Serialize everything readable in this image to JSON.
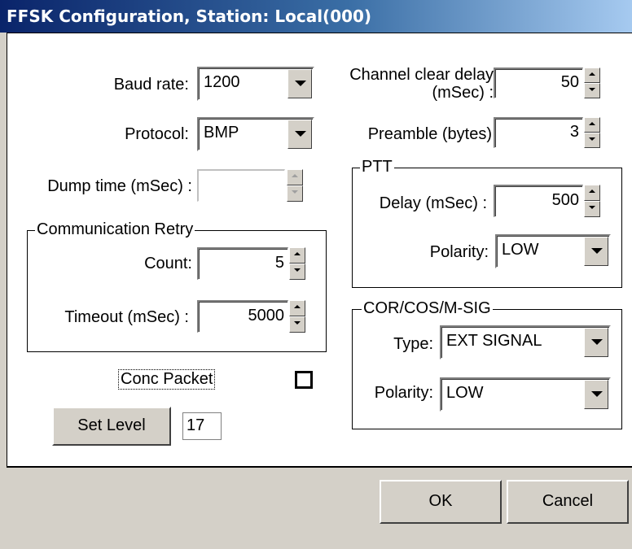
{
  "window": {
    "title": "FFSK Configuration, Station: Local(000)"
  },
  "left": {
    "baud_rate": {
      "label": "Baud rate:",
      "value": "1200"
    },
    "protocol": {
      "label": "Protocol:",
      "value": "BMP"
    },
    "dump_time": {
      "label": "Dump time (mSec) :",
      "value": ""
    },
    "comm_retry": {
      "caption": "Communication Retry",
      "count": {
        "label": "Count:",
        "value": "5"
      },
      "timeout": {
        "label": "Timeout (mSec) :",
        "value": "5000"
      }
    },
    "conc_packet": {
      "label": "Conc Packet",
      "checked": false
    },
    "set_level": {
      "button": "Set Level",
      "value": "17"
    }
  },
  "right": {
    "channel_clear_delay": {
      "label_line1": "Channel clear delay",
      "label_line2": "(mSec) :",
      "value": "50"
    },
    "preamble": {
      "label": "Preamble (bytes)",
      "value": "3"
    },
    "ptt": {
      "caption": "PTT",
      "delay": {
        "label": "Delay (mSec) :",
        "value": "500"
      },
      "polarity": {
        "label": "Polarity:",
        "value": "LOW"
      }
    },
    "cor": {
      "caption": "COR/COS/M-SIG",
      "type": {
        "label": "Type:",
        "value": "EXT SIGNAL"
      },
      "polarity": {
        "label": "Polarity:",
        "value": "LOW"
      }
    }
  },
  "buttons": {
    "ok": "OK",
    "cancel": "Cancel"
  }
}
